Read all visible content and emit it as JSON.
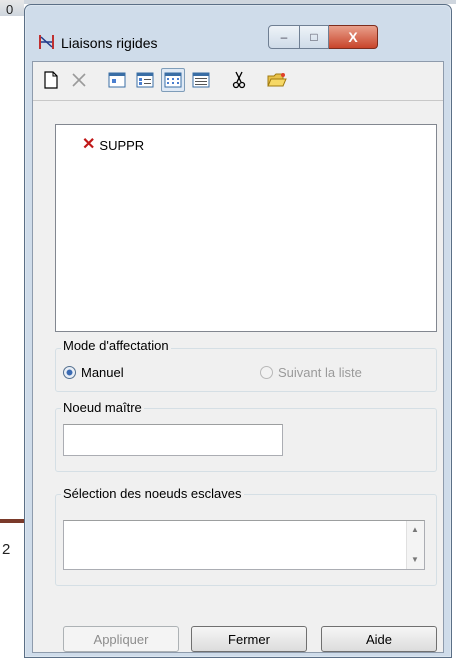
{
  "background": {
    "corner_text": "0",
    "side_text": "2"
  },
  "window": {
    "title": "Liaisons rigides",
    "controls": {
      "minimize": "–",
      "maximize": "□",
      "close": "X"
    }
  },
  "toolbar": {
    "tools": [
      "new-icon",
      "delete-icon",
      "view-1-icon",
      "view-2-icon",
      "view-3-icon",
      "view-4-icon",
      "cut-icon",
      "open-folder-icon"
    ]
  },
  "tree": {
    "items": [
      {
        "label": "SUPPR",
        "icon": "red-x-icon"
      }
    ]
  },
  "mode_group": {
    "label": "Mode d'affectation",
    "option_manual": "Manuel",
    "option_list": "Suivant la liste",
    "selected": "Manuel"
  },
  "master_group": {
    "label": "Noeud maître",
    "value": ""
  },
  "slaves_group": {
    "label": "Sélection des noeuds esclaves",
    "value": ""
  },
  "buttons": {
    "apply": "Appliquer",
    "close": "Fermer",
    "help": "Aide"
  },
  "colors": {
    "titlebar": "#cfdcea",
    "client": "#f0f0f0",
    "close_button": "#c8452b",
    "accent_red": "#c01818"
  }
}
